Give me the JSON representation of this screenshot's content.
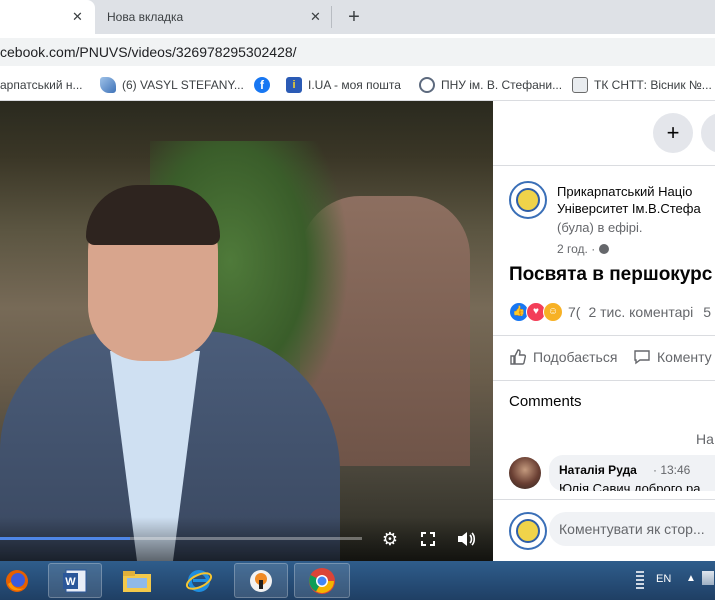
{
  "browser": {
    "tabs": [
      {
        "label": ""
      },
      {
        "label": "Нова вкладка"
      }
    ],
    "url": "cebook.com/PNUVS/videos/326978295302428/",
    "bookmarks": [
      {
        "label": "арпатський н...",
        "icon": "facebook-icon"
      },
      {
        "label": "(6) VASYL STEFANY...",
        "icon": "drop-icon"
      },
      {
        "label": "",
        "icon": "facebook-icon"
      },
      {
        "label": "I.UA - моя пошта",
        "icon": "iua-icon"
      },
      {
        "label": "ПНУ ім. В. Стефани...",
        "icon": "university-icon"
      },
      {
        "label": "ТК СНТТ: Вісник №...",
        "icon": "train-icon"
      }
    ]
  },
  "video": {
    "progress_fraction": 0.36,
    "controls": [
      "settings-icon",
      "fullscreen-icon",
      "volume-icon"
    ]
  },
  "panel": {
    "add_button": "+",
    "page_name_line1": "Прикарпатський Націо",
    "page_name_line2": "Університет Ім.В.Стефа",
    "live_note": "(була) в ефірі.",
    "post_time": "2 год. · ",
    "post_title": "Посвята в першокурс",
    "reaction_count": "7(",
    "comment_count": "2 тис. коментарі",
    "share_count": "5",
    "like_label": "Подобається",
    "comment_label": "Коменту",
    "comments_heading": "Comments",
    "sort_label": "На",
    "comment": {
      "author": "Наталія Руда",
      "time": "· 13:46",
      "text": "Юлія Савич доброго ра"
    },
    "compose_placeholder": "Коментувати як стор..."
  },
  "taskbar": {
    "apps": [
      "firefox-icon",
      "word-icon",
      "explorer-icon",
      "ie-icon",
      "vpn-icon",
      "chrome-icon"
    ],
    "lang": "EN"
  },
  "colors": {
    "accent": "#1877f2",
    "progress": "#4f86e6",
    "taskbar": "#2f5d8c"
  }
}
